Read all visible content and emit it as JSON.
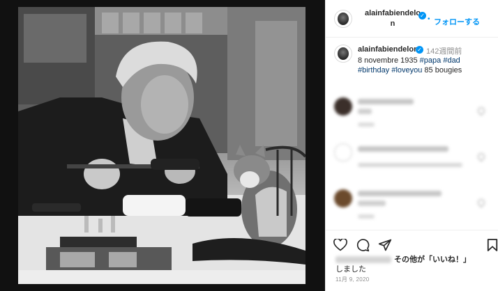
{
  "post": {
    "username": "alainfabiendelon",
    "username_line1": "alainfabiendelo",
    "username_line2": "n",
    "follow_dot": "•",
    "follow_label": "フォローする",
    "more_label": "..."
  },
  "caption": {
    "username": "alainfabiendelon",
    "time_ago": "142週間前",
    "text_before": "8 novembre 1935 ",
    "tags": [
      "#papa",
      "#dad",
      "#birthday",
      "#loveyou"
    ],
    "text_after": " 85 bougies"
  },
  "likes": {
    "suffix_bold": "その他が「いいね！」",
    "line2": "しました"
  },
  "date": "11月 9, 2020",
  "icons": [
    "heart-icon",
    "comment-icon",
    "share-icon",
    "bookmark-icon",
    "verified-badge-icon"
  ],
  "colors": {
    "accent": "#0095f6",
    "hashtag": "#00376b",
    "muted": "#8e8e8e"
  }
}
